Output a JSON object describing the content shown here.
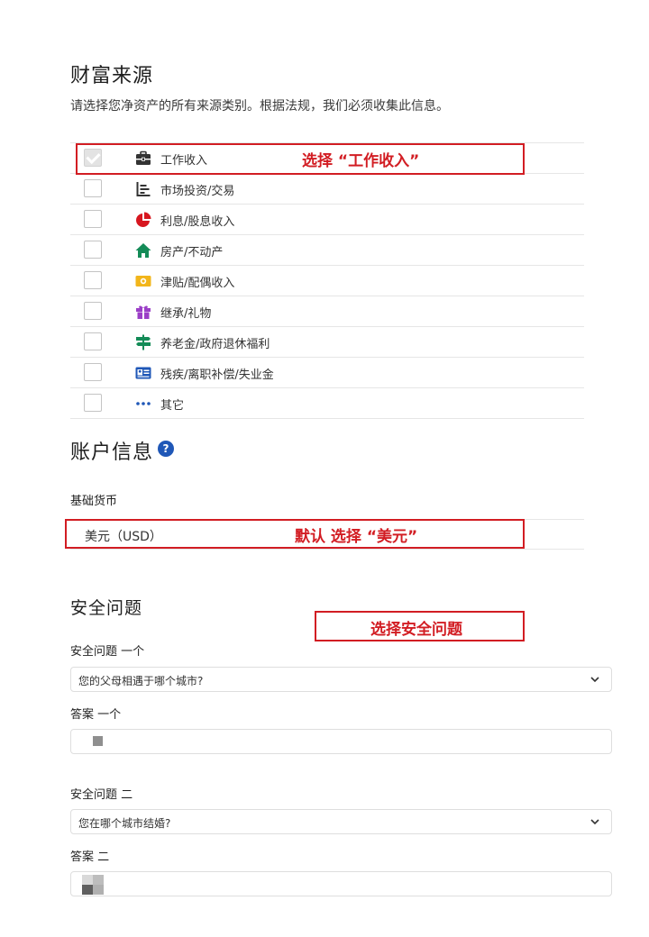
{
  "wealth_source": {
    "title": "财富来源",
    "description": "请选择您净资产的所有来源类别。根据法规，我们必须收集此信息。",
    "items": [
      {
        "label": "工作收入",
        "checked": true,
        "icon": "briefcase-icon",
        "color": "#333333"
      },
      {
        "label": "市场投资/交易",
        "checked": false,
        "icon": "bar-chart-icon",
        "color": "#333333"
      },
      {
        "label": "利息/股息收入",
        "checked": false,
        "icon": "pie-chart-icon",
        "color": "#d7161f"
      },
      {
        "label": "房产/不动产",
        "checked": false,
        "icon": "house-icon",
        "color": "#138b57"
      },
      {
        "label": "津贴/配偶收入",
        "checked": false,
        "icon": "cash-icon",
        "color": "#f2b51a"
      },
      {
        "label": "继承/礼物",
        "checked": false,
        "icon": "gift-icon",
        "color": "#9b3fc7"
      },
      {
        "label": "养老金/政府退休福利",
        "checked": false,
        "icon": "signpost-icon",
        "color": "#138b57"
      },
      {
        "label": "残疾/离职补偿/失业金",
        "checked": false,
        "icon": "id-card-icon",
        "color": "#1f57b7"
      },
      {
        "label": "其它",
        "checked": false,
        "icon": "more-icon",
        "color": "#1f57b7"
      }
    ]
  },
  "account_info": {
    "title": "账户信息",
    "help_icon": "?",
    "base_currency_label": "基础货币",
    "base_currency_value": "美元（USD）"
  },
  "security": {
    "title": "安全问题",
    "q1_label": "安全问题 一个",
    "q1_value": "您的父母相遇于哪个城市?",
    "a1_label": "答案 一个",
    "q2_label": "安全问题 二",
    "q2_value": "您在哪个城市结婚?",
    "a2_label": "答案 二"
  },
  "annotations": {
    "work_income": "选择 “工作收入”",
    "currency": "默认 选择 “美元”",
    "security": "选择安全问题",
    "color": "#d21d23"
  }
}
